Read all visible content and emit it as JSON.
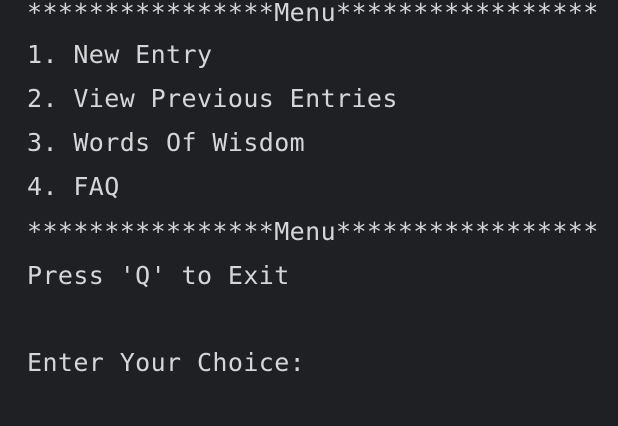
{
  "terminal": {
    "menu_header": "****************Menu*****************",
    "menu_footer": "****************Menu*****************",
    "items": [
      "1. New Entry",
      "2. View Previous Entries",
      "3. Words Of Wisdom",
      "4. FAQ"
    ],
    "exit_hint": "Press 'Q' to Exit",
    "prompt": "Enter Your Choice:"
  },
  "colors": {
    "background": "#1f2023",
    "text": "#d5d6d8"
  }
}
